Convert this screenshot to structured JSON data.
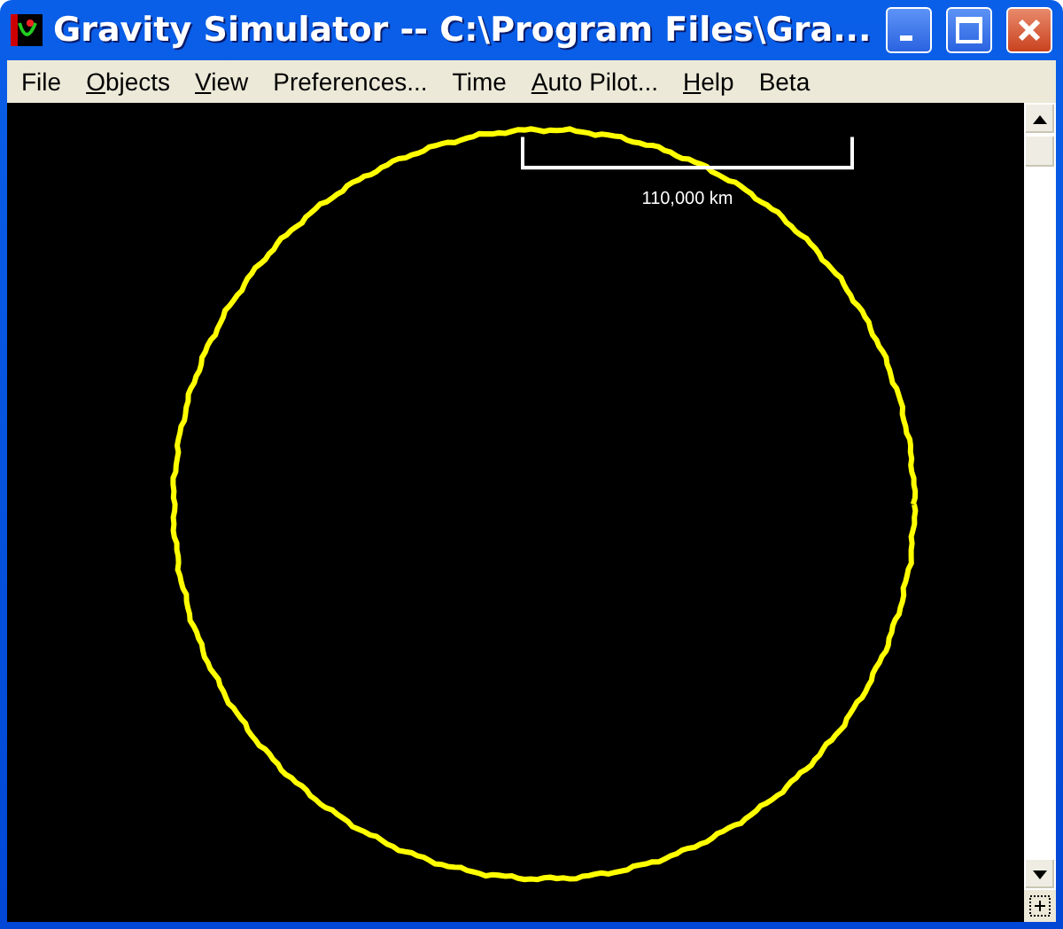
{
  "window": {
    "title": "Gravity Simulator -- C:\\Program Files\\Gra..."
  },
  "menu": [
    {
      "rest": "File"
    },
    {
      "accel": "O",
      "rest": "bjects"
    },
    {
      "accel": "V",
      "rest": "iew"
    },
    {
      "rest": "Preferences..."
    },
    {
      "rest": "Time"
    },
    {
      "accel": "A",
      "rest": "uto Pilot..."
    },
    {
      "accel": "H",
      "rest": "elp"
    },
    {
      "rest": "Beta"
    }
  ],
  "scale": {
    "label": "110,000 km"
  }
}
